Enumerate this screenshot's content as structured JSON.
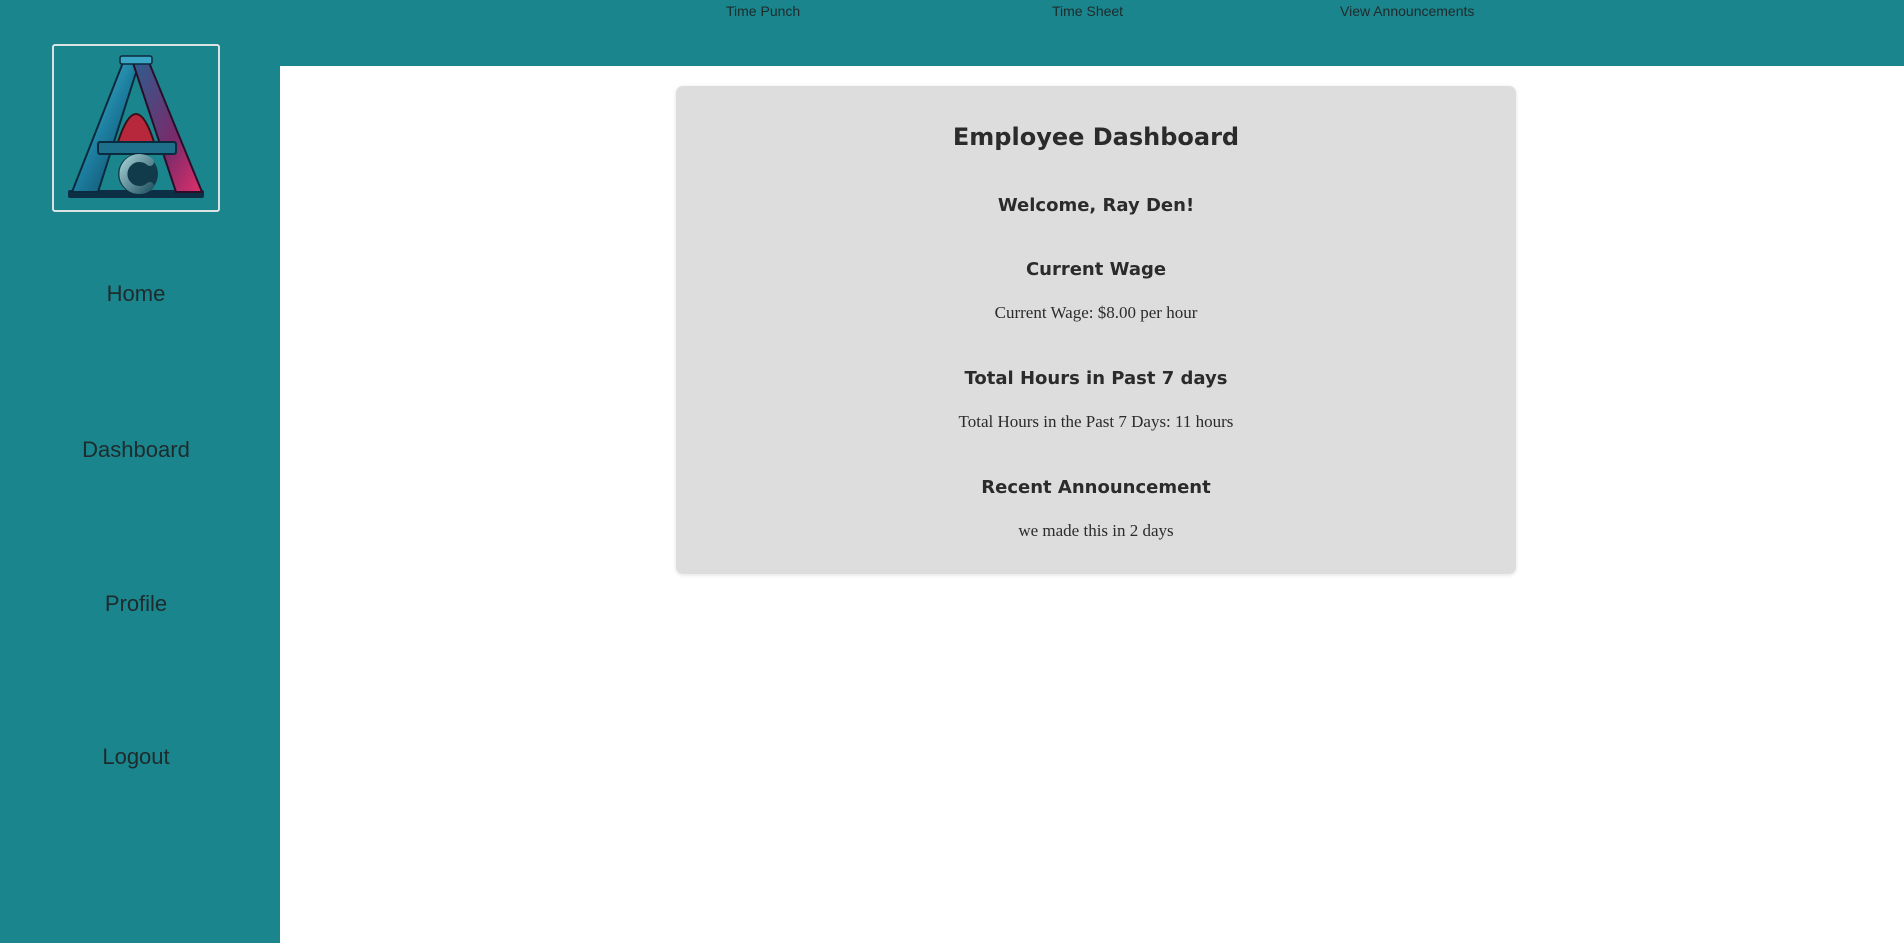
{
  "sidebar": {
    "logo_icon": "ac-logo-icon",
    "items": [
      {
        "label": "Home"
      },
      {
        "label": "Dashboard"
      },
      {
        "label": "Profile"
      },
      {
        "label": "Logout"
      }
    ]
  },
  "topnav": {
    "links": [
      {
        "label": "Time Punch"
      },
      {
        "label": "Time Sheet"
      },
      {
        "label": "View Announcements"
      }
    ]
  },
  "dashboard": {
    "title": "Employee Dashboard",
    "welcome": "Welcome, Ray Den!",
    "wage_heading": "Current Wage",
    "wage_text": "Current Wage: $8.00 per hour",
    "hours_heading": "Total Hours in Past 7 days",
    "hours_text": "Total Hours in the Past 7 Days: 11 hours",
    "announcement_heading": "Recent Announcement",
    "announcement_text": "we made this in 2 days"
  },
  "colors": {
    "brand_teal": "#1a858d",
    "card_bg": "#dddddd",
    "page_bg": "#ffffff"
  }
}
